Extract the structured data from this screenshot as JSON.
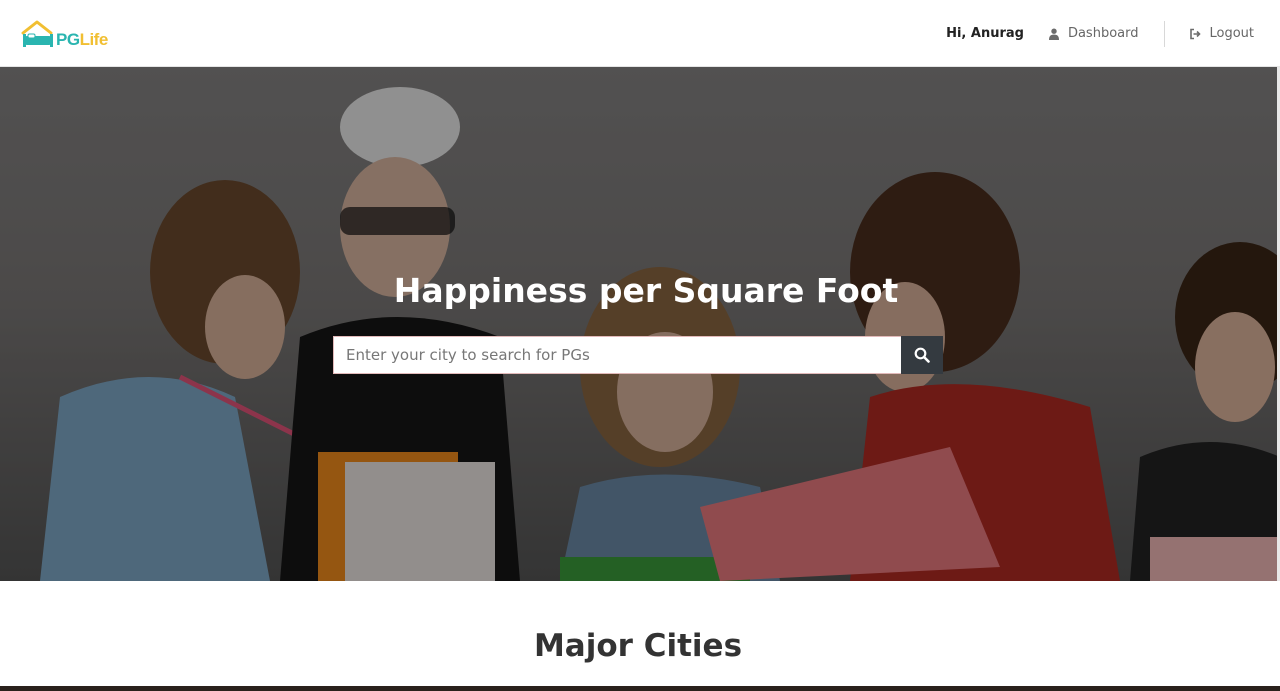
{
  "brand": {
    "pg": "PG",
    "life": "Life"
  },
  "nav": {
    "greeting": "Hi, Anurag",
    "dashboard": "Dashboard",
    "logout": "Logout"
  },
  "hero": {
    "title": "Happiness per Square Foot",
    "search_placeholder": "Enter your city to search for PGs"
  },
  "sections": {
    "major_cities": "Major Cities"
  },
  "icons": {
    "logo": "house-bed-logo",
    "dashboard": "user-icon",
    "logout": "sign-out-icon",
    "search": "search-icon"
  },
  "colors": {
    "teal": "#2ab5b0",
    "yellow": "#f1bf32",
    "dark": "#343a40"
  }
}
